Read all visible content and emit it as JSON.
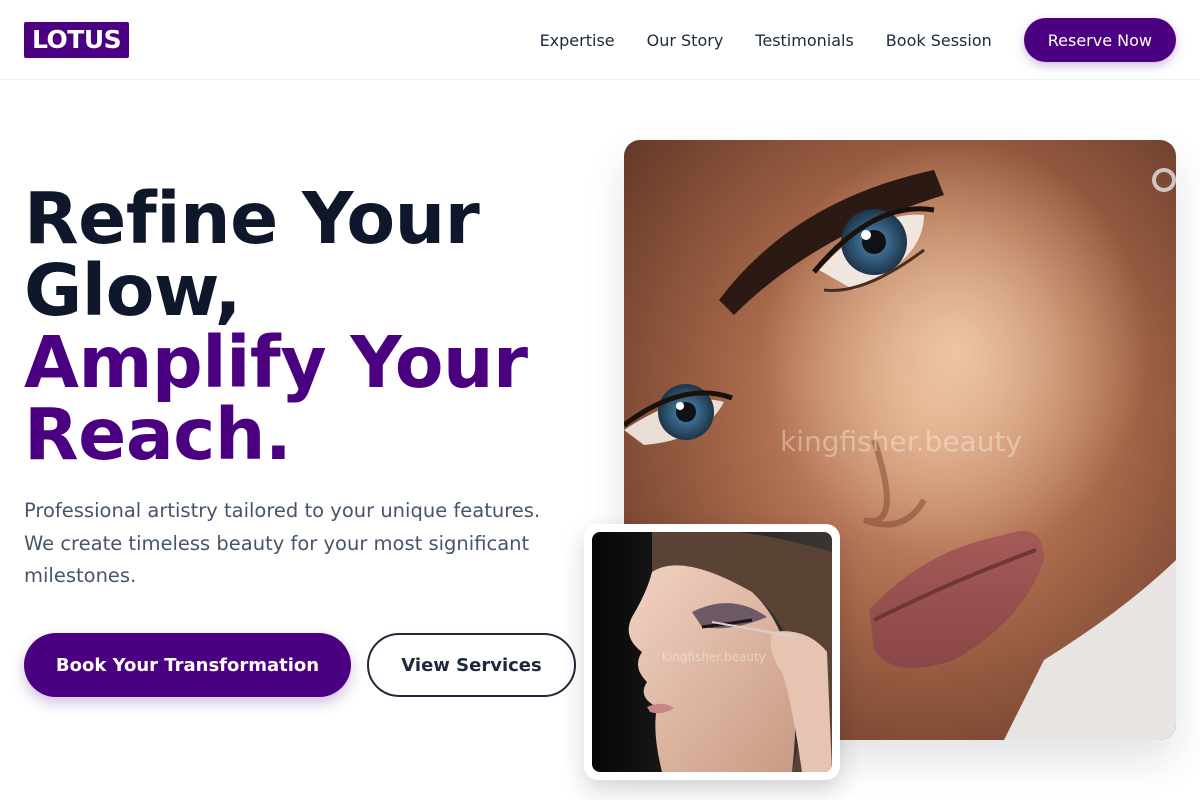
{
  "brand": {
    "logo_text": "LOTUS",
    "accent_color": "#4b0082"
  },
  "nav": {
    "links": [
      "Expertise",
      "Our Story",
      "Testimonials",
      "Book Session"
    ],
    "cta_label": "Reserve Now"
  },
  "hero": {
    "headline_line1": "Refine Your",
    "headline_line2": "Glow,",
    "headline_accent_line1": "Amplify Your",
    "headline_accent_line2": "Reach.",
    "subtext": "Professional artistry tailored to your unique features. We create timeless beauty for your most significant milestones.",
    "primary_button": "Book Your Transformation",
    "secondary_button": "View Services"
  },
  "images": {
    "main_watermark": "kingfisher.beauty",
    "inset_watermark": "kingfisher.beauty"
  }
}
